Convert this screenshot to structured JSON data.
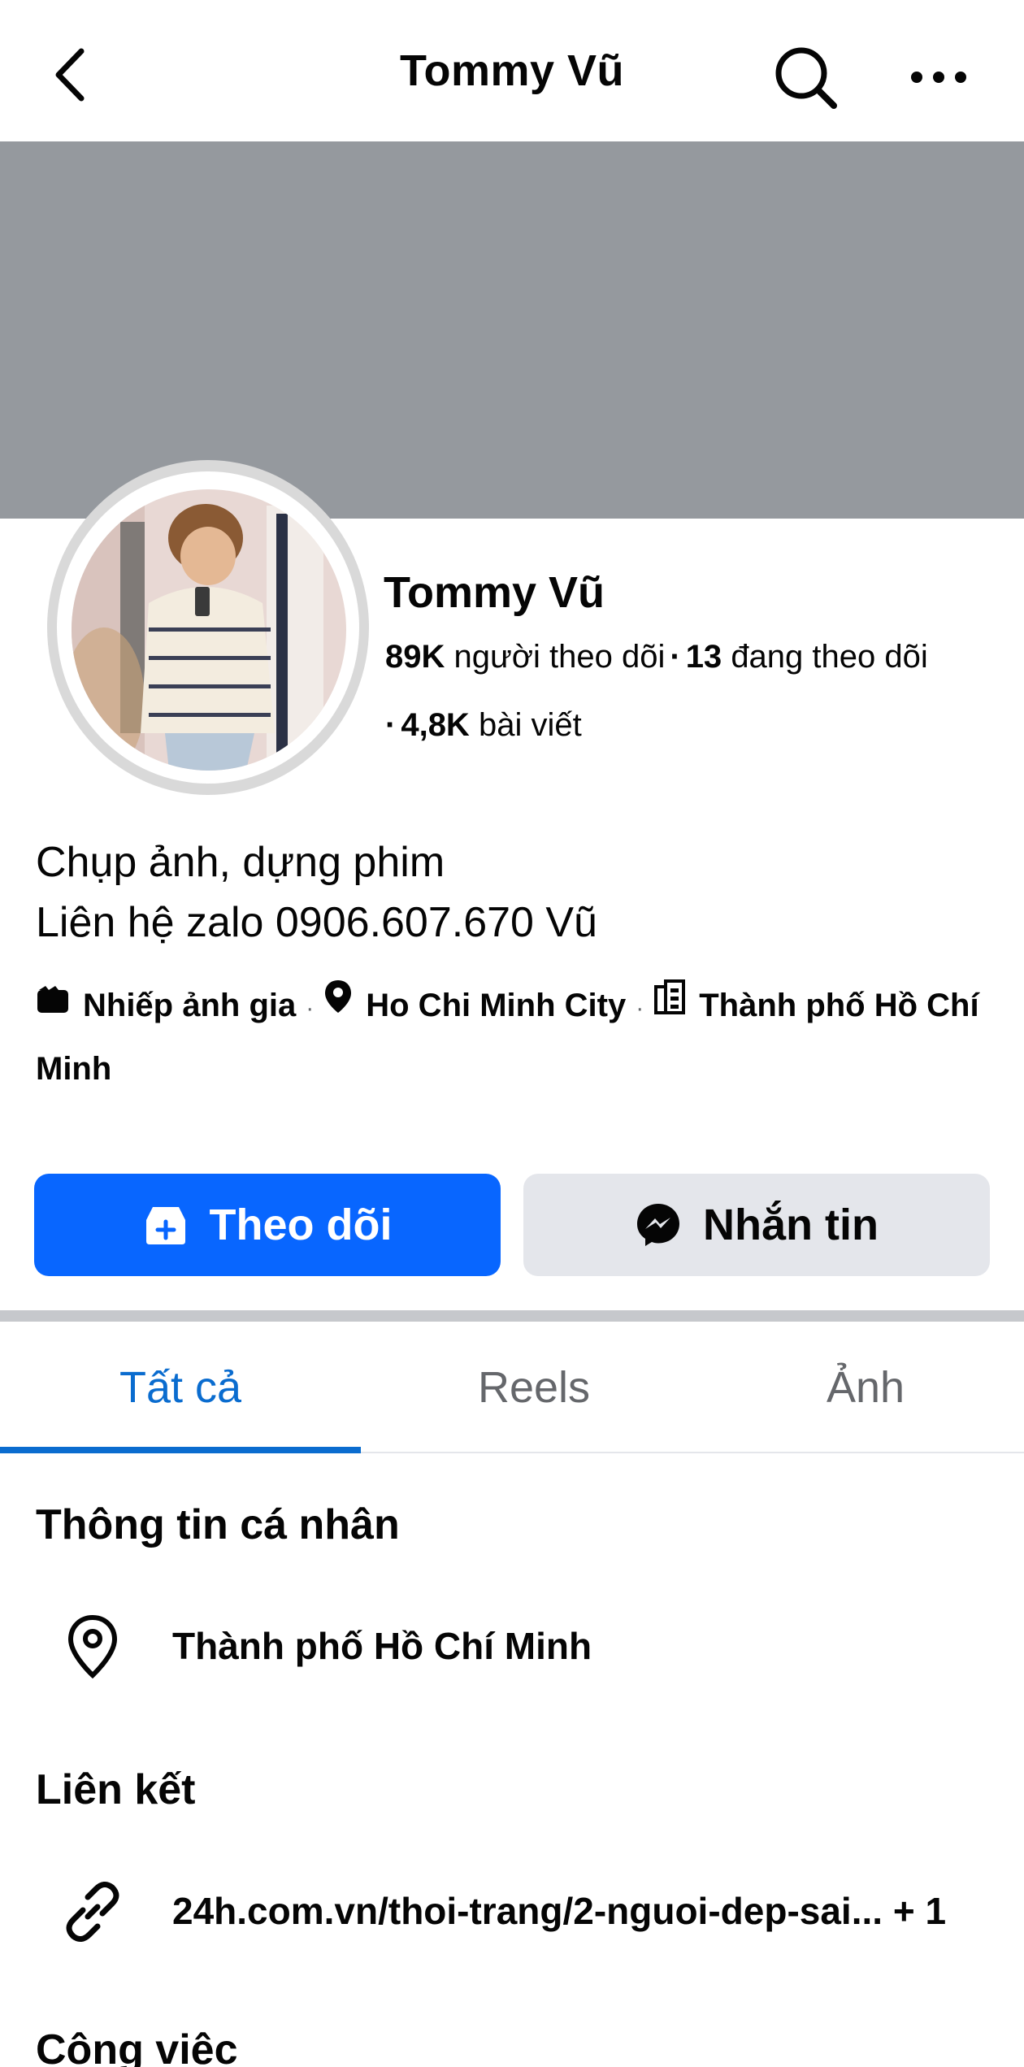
{
  "header": {
    "title": "Tommy Vũ",
    "back_icon": "back-arrow-icon",
    "search_icon": "search-icon",
    "more_icon": "more-icon"
  },
  "profile": {
    "name": "Tommy Vũ",
    "followers_count": "89K",
    "followers_label": "người theo dõi",
    "following_count": "13",
    "following_label": "đang theo dõi",
    "posts_count": "4,8K",
    "posts_label": "bài viết"
  },
  "bio": {
    "line1": "Chụp ảnh, dựng phim",
    "line2": "Liên hệ zalo 0906.607.670 Vũ"
  },
  "details": {
    "category": "Nhiếp ảnh gia",
    "location": "Ho Chi Minh City",
    "hometown": "Thành phố Hồ Chí Minh"
  },
  "actions": {
    "follow_label": "Theo dõi",
    "message_label": "Nhắn tin"
  },
  "tabs": [
    {
      "label": "Tất cả",
      "active": true
    },
    {
      "label": "Reels",
      "active": false
    },
    {
      "label": "Ảnh",
      "active": false
    }
  ],
  "personal_info": {
    "title": "Thông tin cá nhân",
    "city": "Thành phố Hồ Chí Minh"
  },
  "links": {
    "title": "Liên kết",
    "url": "24h.com.vn/thoi-trang/2-nguoi-dep-sai...",
    "extra": "+ 1"
  },
  "work": {
    "title": "Công việc"
  },
  "colors": {
    "primary_blue": "#0866ff",
    "tab_active": "#0a6ccf",
    "cover_gray": "#95999e",
    "secondary_button": "#e4e6eb"
  }
}
